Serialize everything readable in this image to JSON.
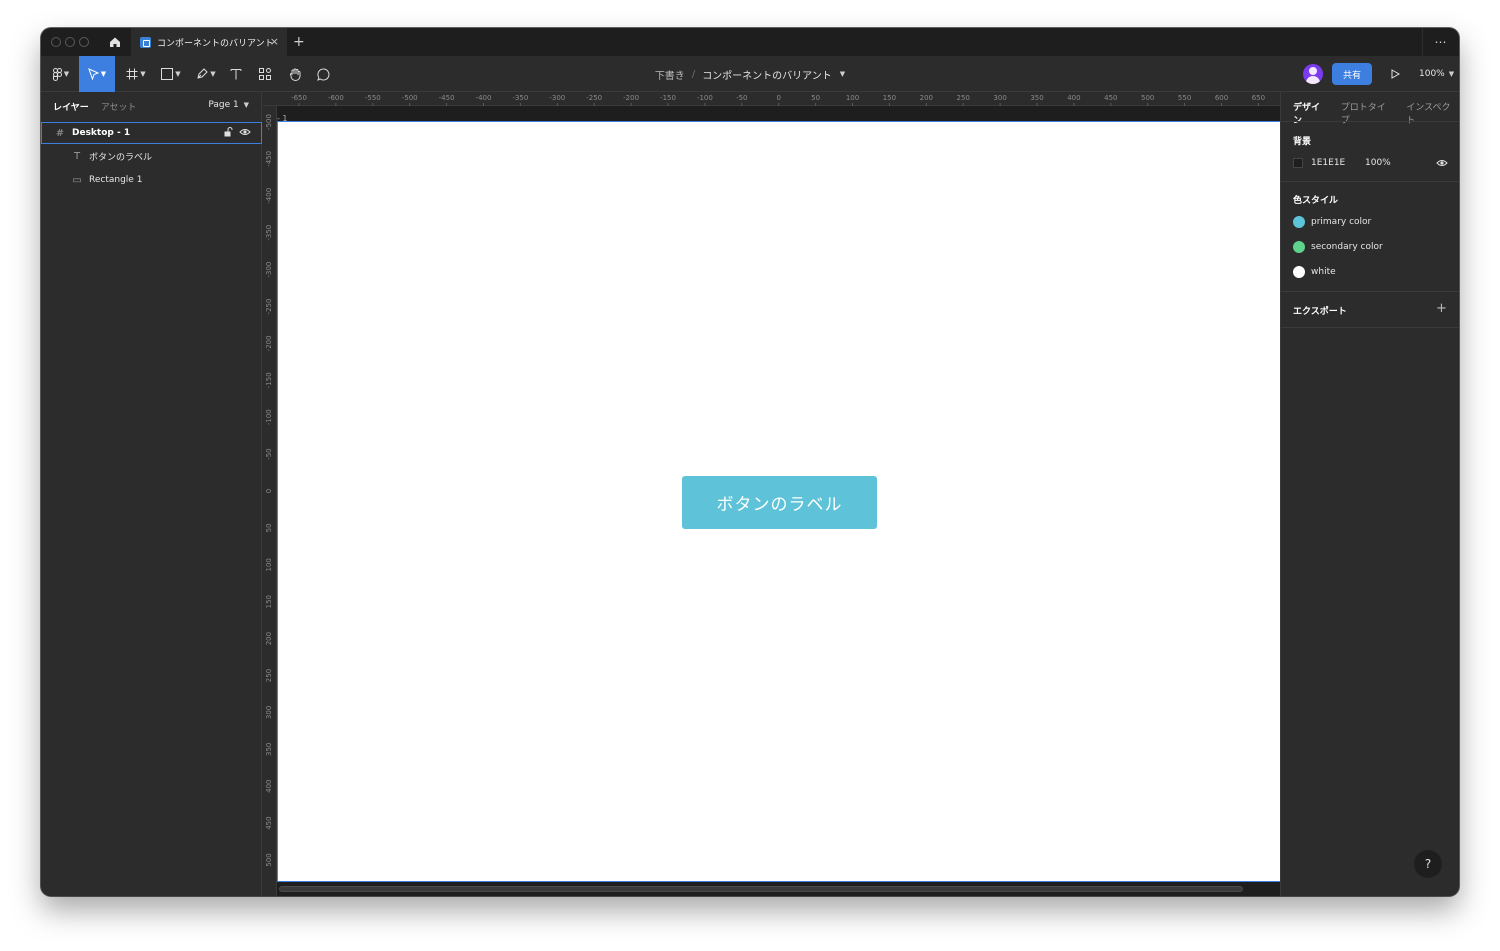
{
  "titlebar": {
    "tab_label": "コンポーネントのバリアント",
    "close_glyph": "×",
    "add_glyph": "+",
    "more_glyph": "⋯"
  },
  "toolbar": {
    "breadcrumb_folder": "下書き",
    "breadcrumb_sep": "/",
    "file_name": "コンポーネントのバリアント",
    "share_label": "共有",
    "zoom_label": "100%"
  },
  "left_panel": {
    "tabs": [
      "レイヤー",
      "アセット"
    ],
    "page_selector": "Page 1",
    "layers": [
      {
        "name": "Desktop - 1",
        "icon": "frame-icon",
        "selected": true
      },
      {
        "name": "ボタンのラベル",
        "icon": "text-icon",
        "selected": false
      },
      {
        "name": "Rectangle 1",
        "icon": "rectangle-icon",
        "selected": false
      }
    ]
  },
  "canvas": {
    "frame_label": "- 1",
    "button_text": "ボタンのラベル",
    "button_color": "#5ec3d8",
    "ruler_top": [
      "-650",
      "-600",
      "-550",
      "-500",
      "-450",
      "-400",
      "-350",
      "-300",
      "-250",
      "-200",
      "-150",
      "-100",
      "-50",
      "0",
      "50",
      "100",
      "150",
      "200",
      "250",
      "300",
      "350",
      "400",
      "450",
      "500",
      "550",
      "600",
      "650"
    ],
    "ruler_left": [
      "-500",
      "-450",
      "-400",
      "-350",
      "-300",
      "-250",
      "-200",
      "-150",
      "-100",
      "-50",
      "0",
      "50",
      "100",
      "150",
      "200",
      "250",
      "300",
      "350",
      "400",
      "450",
      "500"
    ]
  },
  "right_panel": {
    "tabs": [
      "デザイン",
      "プロトタイプ",
      "インスペクト"
    ],
    "background_heading": "背景",
    "background_hex": "1E1E1E",
    "background_opacity": "100%",
    "color_styles_heading": "色スタイル",
    "color_styles": [
      {
        "name": "primary color",
        "color": "#5ec3d8"
      },
      {
        "name": "secondary color",
        "color": "#5fd38d"
      },
      {
        "name": "white",
        "color": "#ffffff"
      }
    ],
    "export_heading": "エクスポート",
    "help_glyph": "?"
  },
  "colors": {
    "accent": "#3d7fe0",
    "panel": "#2c2c2c",
    "canvas": "#1e1e1e"
  }
}
